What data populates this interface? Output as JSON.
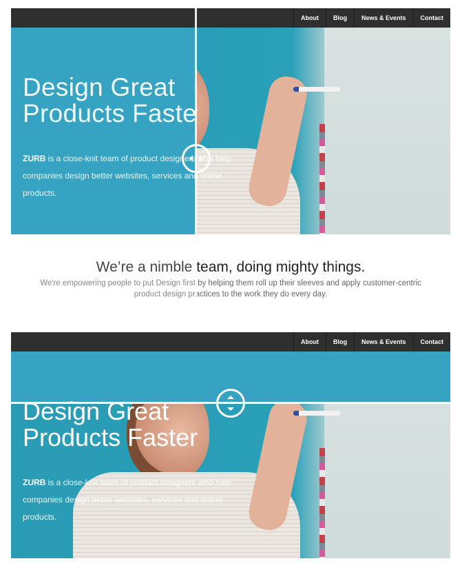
{
  "nav": {
    "items": [
      "About",
      "Blog",
      "News & Events",
      "Contact"
    ]
  },
  "hero": {
    "headline_line1": "Design Great",
    "headline_line2": "Products Faster",
    "brand": "ZURB",
    "body": " is a close-knit team of product designers who help companies design better websites, services and online products."
  },
  "lower": {
    "heading": "We’re a nimble team, doing mighty things.",
    "text": "We're empowering people to put Design first by helping them roll up their sleeves and apply customer-centric product design practices to the work they do every day."
  },
  "colors": {
    "accent": "#35a3c1",
    "nav": "#2f2f2f"
  },
  "comparison": {
    "top": {
      "orientation": "horizontal",
      "split_percent": 42
    },
    "bottom": {
      "orientation": "vertical",
      "split_percent": 31
    }
  },
  "icons": {
    "top_handle": "arrows-left-right-icon",
    "bottom_handle": "arrows-up-down-icon"
  }
}
